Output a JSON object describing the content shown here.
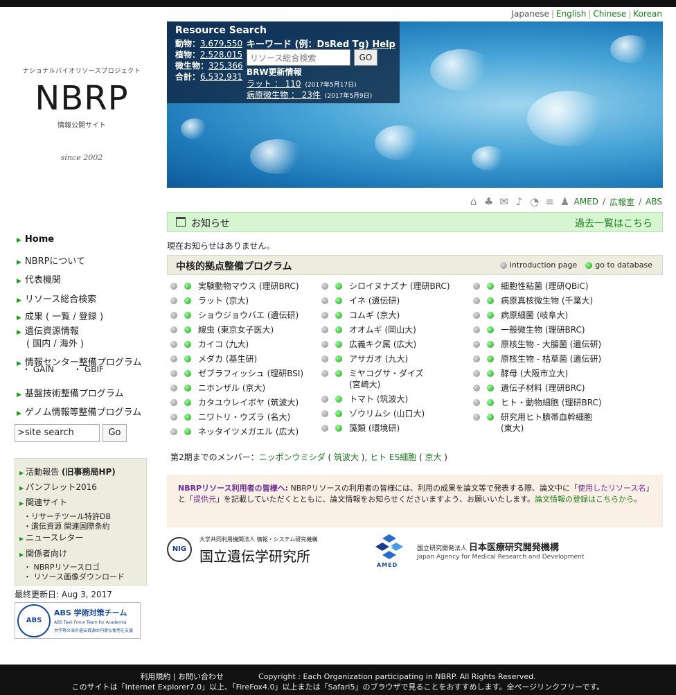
{
  "langs": [
    "Japanese",
    "English",
    "Chinese",
    "Korean"
  ],
  "logo": {
    "project": "ナショナルバイオリソースプロジェクト",
    "name": "NBRP",
    "subtitle": "情報公開サイト",
    "since": "since 2002"
  },
  "resource_search": {
    "title": "Resource Search",
    "stats": [
      {
        "label": "動物：",
        "value": "3,679,550"
      },
      {
        "label": "植物：",
        "value": "2,528,015"
      },
      {
        "label": "微生物：",
        "value": "325,366"
      },
      {
        "label": "合計：",
        "value": "6,532,931"
      }
    ],
    "keyword_label": "キーワード (例：DsRed Tg)",
    "help": "Help",
    "placeholder": "リソース総合検索",
    "go": "GO",
    "brw_title": "BRW更新情報",
    "brw": [
      {
        "link": "ラット ： 110",
        "date": "(2017年5月17日)"
      },
      {
        "link": "病原微生物 ： 23件",
        "date": "(2017年5月9日)"
      }
    ]
  },
  "top_links": [
    "AMED",
    "広報室",
    "ABS"
  ],
  "notice": {
    "title": "お知らせ",
    "past": "過去一覧はこちら",
    "none": "現在お知らせはありません。"
  },
  "program": {
    "title": "中核的拠点整備プログラム",
    "legend_intro": "introduction page",
    "legend_db": "go to database",
    "col1": [
      "実験動物マウス (理研BRC)",
      "ラット (京大)",
      "ショウジョウバエ (遺伝研)",
      "線虫 (東京女子医大)",
      "カイコ (九大)",
      "メダカ (基生研)",
      "ゼブラフィッシュ (理研BSI)",
      "ニホンザル (京大)",
      "カタユウレイボヤ (筑波大)",
      "ニワトリ・ウズラ (名大)",
      "ネッタイツメガエル (広大)"
    ],
    "col2": [
      "シロイヌナズナ (理研BRC)",
      "イネ (遺伝研)",
      "コムギ (京大)",
      "オオムギ (岡山大)",
      "広義キク属 (広大)",
      "アサガオ (九大)",
      "ミヤコグサ・ダイズ\n(宮崎大)",
      "トマト (筑波大)",
      "ゾウリムシ (山口大)",
      "藻類 (環境研)"
    ],
    "col3": [
      "細胞性粘菌 (理研QBiC)",
      "病原真核微生物 (千葉大)",
      "病原細菌 (岐阜大)",
      "一般微生物 (理研BRC)",
      "原核生物 - 大腸菌 (遺伝研)",
      "原核生物 - 枯草菌 (遺伝研)",
      "酵母 (大阪市立大)",
      "遺伝子材料 (理研BRC)",
      "ヒト・動物細胞 (理研BRC)",
      "研究用ヒト臍帯血幹細胞\n(東大)"
    ]
  },
  "members": {
    "prefix": "第2期までのメンバー：",
    "m1": "ニッポンウミシダ",
    "m1org": "筑波大",
    "m2": "ヒト ES細胞",
    "m2org": "京大"
  },
  "userbox": {
    "head": "NBRPリソース利用者の皆様へ:",
    "t1": " NBRPリソースの利用者の皆様には、利用の成果を論文等で発表する際、論文中に「",
    "p1": "使用したリソース名",
    "t2": "」と「",
    "p2": "提供元",
    "t3": "」を記載していただくとともに、論文情報をお知らせくださいますよう、お願いいたします。",
    "link": "論文情報の登録はこちらから",
    "end": "。"
  },
  "nig": {
    "seal": "NIG",
    "small": "大学共同利用機関法人 情報・システム研究機構",
    "big": "国立遺伝学研究所"
  },
  "amed": {
    "label": "AMED",
    "l1small": "国立研究開発法人",
    "l1big": "日本医療研究開発機構",
    "l2": "Japan Agency for Medical Research and Development"
  },
  "nav": {
    "home": "Home",
    "about": "NBRPについて",
    "rep": "代表機関",
    "search": "リソース総合検索",
    "results": "成果 ( 一覧 / 登録 )",
    "genetic1": "遺伝資源情報",
    "genetic2": "( 国内 / 海外 )",
    "info": "情報センター整備プログラム",
    "gain": "・ GAIN",
    "gbif": "・ GBIF",
    "tech": "基盤技術整備プログラム",
    "genome": "ゲノム情報等整備プログラム"
  },
  "site_search": {
    "value": ">site search",
    "go": "Go"
  },
  "leftbox": {
    "activity": "活動報告 ",
    "activity_b": "(旧事務局HP)",
    "pamphlet": "パンフレット2016",
    "related": "関連サイト",
    "sub1": "・リサーチツール特許DB",
    "sub2": "・遺伝資源 関連国際条約",
    "news": "ニュースレター",
    "staff": "関係者向け",
    "sub3": "・ NBRPリソースロゴ",
    "sub4": "・ リソース画像ダウンロード"
  },
  "updated": "最終更新日: Aug 3, 2017",
  "abs": {
    "seal": "ABS",
    "t1": "ABS 学術対策チーム",
    "t2": "ABS Task Force Team for Academia",
    "t3": "大学等の海外遺伝資源の円滑な使用を支援"
  },
  "footer": {
    "links": "利用規約 | お問い合わせ",
    "copy": "Copyright : Each Organization participating in NBRP. All Rights Reserved.",
    "note": "このサイトは「Internet Explorer7.0」以上、「FireFox4.0」以上または「Safari5」のブラウザで見ることをおすすめします。全ページリンクフリーです。"
  },
  "colors": {
    "accent_green": "#1a7a1a",
    "notice_bg": "#d6f6d2",
    "program_bg": "#ececdf",
    "userbox_bg": "#faf0e6",
    "footer_bg": "#111111"
  }
}
